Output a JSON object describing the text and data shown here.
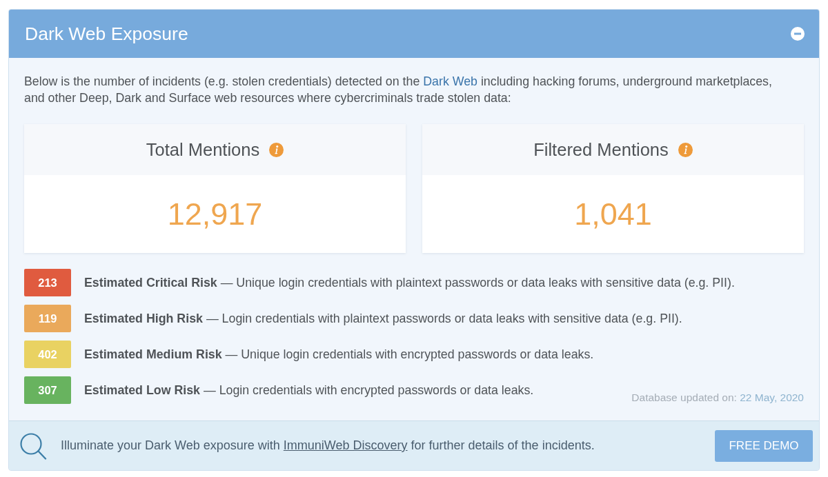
{
  "panel": {
    "title": "Dark Web Exposure",
    "expanded": true
  },
  "intro": {
    "text_before": "Below is the number of incidents (e.g. stolen credentials) detected on the ",
    "link": "Dark Web",
    "text_after": " including hacking forums, underground marketplaces, and other Deep, Dark and Surface web resources where cybercriminals trade stolen data:"
  },
  "metrics": [
    {
      "title": "Total Mentions",
      "value": "12,917"
    },
    {
      "title": "Filtered Mentions",
      "value": "1,041"
    }
  ],
  "risks": [
    {
      "count": "213",
      "color": "#e05b3f",
      "text": "**Estimated Critical Risk** — Unique login credentials with plaintext passwords or data leaks with sensitive data (e.g. PII)."
    },
    {
      "count": "119",
      "color": "#eaa95b",
      "text": "**Estimated High Risk** — Login credentials with plaintext passwords or data leaks with sensitive data (e.g. PII)."
    },
    {
      "count": "402",
      "color": "#e9d262",
      "text": "**Estimated Medium Risk** — Unique login credentials with encrypted passwords or data leaks."
    },
    {
      "count": "307",
      "color": "#68b35f",
      "text": "**Estimated Low Risk** — Login credentials with encrypted passwords or data leaks."
    }
  ],
  "database_updated": {
    "label": "Database updated on:",
    "date": "22 May, 2020"
  },
  "footer": {
    "text_before": "Illuminate your Dark Web exposure with ",
    "link": "ImmuniWeb Discovery",
    "text_after": " for further details of the incidents.",
    "button": "FREE DEMO"
  }
}
